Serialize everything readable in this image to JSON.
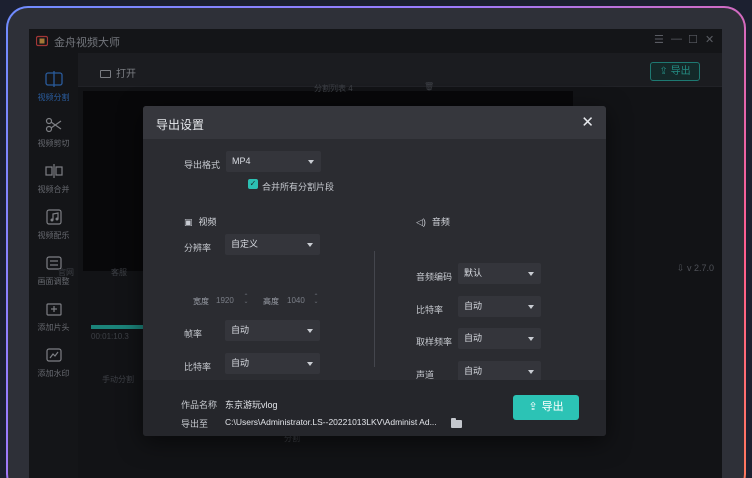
{
  "app": {
    "title": "金舟视频大师",
    "window_controls": [
      "☰",
      "—",
      "☐",
      "✕"
    ]
  },
  "sidebar": {
    "items": [
      {
        "label": "视频分割",
        "icon": "split-icon",
        "active": true
      },
      {
        "label": "视频剪切",
        "icon": "cut-icon"
      },
      {
        "label": "视频合并",
        "icon": "merge-icon"
      },
      {
        "label": "视频配乐",
        "icon": "music-icon"
      },
      {
        "label": "画面调整",
        "icon": "adjust-icon"
      },
      {
        "label": "添加片头",
        "icon": "intro-icon"
      },
      {
        "label": "添加水印",
        "icon": "watermark-icon"
      }
    ]
  },
  "toolbar": {
    "open_label": "打开",
    "export_label": "导出"
  },
  "background": {
    "split_list_label": "分割列表 4",
    "side_tabs": [
      "官网",
      "客服"
    ],
    "timestamp": "00:01:10.3",
    "manual_split_label": "手动分割",
    "split_label": "分割",
    "version": "v 2.7.0"
  },
  "dialog": {
    "title": "导出设置",
    "format_label": "导出格式",
    "format_value": "MP4",
    "merge_label": "合并所有分割片段",
    "merge_checked": true,
    "video": {
      "section_label": "视频",
      "resolution_label": "分辨率",
      "resolution_value": "自定义",
      "width_label": "宽度",
      "width_value": "1920",
      "height_label": "高度",
      "height_value": "1040",
      "framerate_label": "帧率",
      "framerate_value": "自动",
      "bitrate_label": "比特率",
      "bitrate_value": "自动"
    },
    "audio": {
      "section_label": "音频",
      "codec_label": "音频编码",
      "codec_value": "默认",
      "bitrate_label": "比特率",
      "bitrate_value": "自动",
      "samplerate_label": "取样频率",
      "samplerate_value": "自动",
      "channel_label": "声道",
      "channel_value": "自动"
    },
    "footer": {
      "name_label": "作品名称",
      "name_value": "东京游玩vlog",
      "path_label": "导出至",
      "path_value": "C:\\Users\\Administrator.LS--20221013LKV\\Administ Ad...",
      "export_label": "导出"
    }
  },
  "colors": {
    "accent": "#2cc3b5",
    "active_nav": "#3a7fd9",
    "dialog_bg": "#2b2c31"
  }
}
